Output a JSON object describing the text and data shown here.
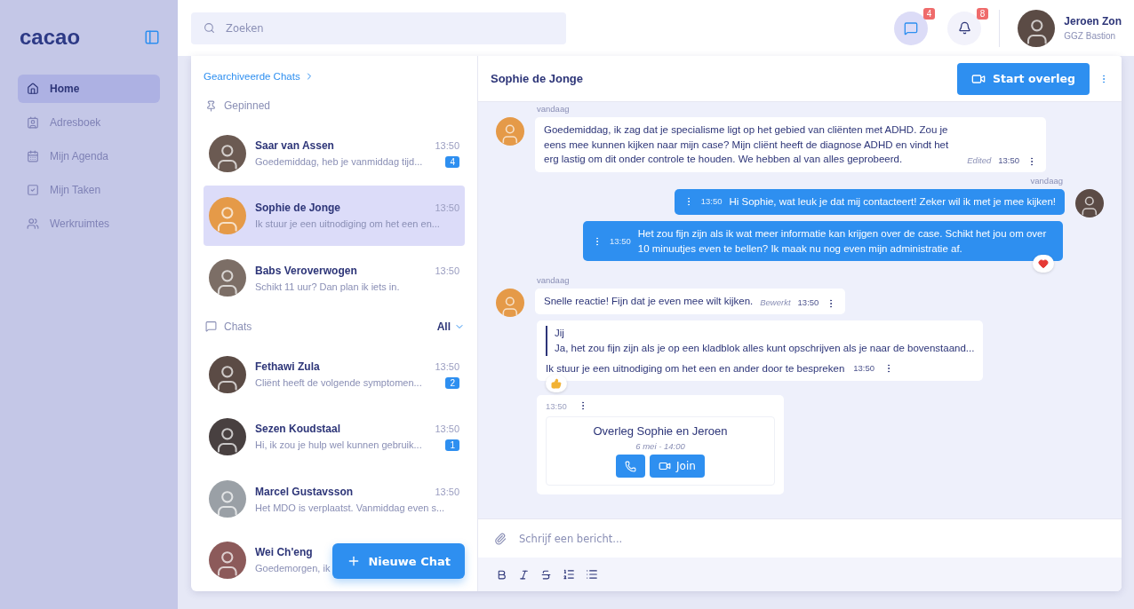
{
  "sidebar": {
    "logo": "cacao",
    "items": [
      {
        "label": "Home",
        "selected": true
      },
      {
        "label": "Adresboek",
        "selected": false
      },
      {
        "label": "Mijn Agenda",
        "selected": false
      },
      {
        "label": "Mijn Taken",
        "selected": false
      },
      {
        "label": "Werkruimtes",
        "selected": false
      }
    ]
  },
  "topbar": {
    "search": {
      "placeholder": "Zoeken"
    },
    "chat_badge": "4",
    "notification_badge": "8",
    "user": {
      "name": "Jeroen Zon",
      "org": "GGZ Bastion"
    }
  },
  "chat_list": {
    "archived_link": "Gearchiveerde Chats",
    "pinned_heading": "Gepinned",
    "pinned": [
      {
        "name": "Saar van Assen",
        "time": "13:50",
        "preview": "Goedemiddag, heb je vanmiddag tijd...",
        "unread": "4",
        "selected": false
      },
      {
        "name": "Sophie de Jonge",
        "time": "13:50",
        "preview": "Ik stuur je een uitnodiging om het een en...",
        "selected": true
      },
      {
        "name": "Babs Veroverwogen",
        "time": "13:50",
        "preview": "Schikt 11 uur? Dan plan ik iets in.",
        "selected": false
      }
    ],
    "chats_heading": "Chats",
    "filter": "All",
    "chats": [
      {
        "name": "Fethawi Zula",
        "time": "13:50",
        "preview": "Cliënt heeft de volgende symptomen...",
        "unread": "2",
        "selected": false
      },
      {
        "name": "Sezen Koudstaal",
        "time": "13:50",
        "preview": "Hi, ik zou je hulp wel kunnen gebruik...",
        "unread": "1",
        "selected": false
      },
      {
        "name": "Marcel Gustavsson",
        "time": "13:50",
        "preview": "Het MDO is verplaatst. Vanmiddag even s...",
        "selected": false
      },
      {
        "name": "Wei Ch'eng",
        "preview": "Goedemorgen, ik",
        "selected": false
      }
    ],
    "new_chat_button": "Nieuwe Chat"
  },
  "conversation": {
    "title": "Sophie de Jonge",
    "start_button": "Start overleg",
    "messages": [
      {
        "kind": "incoming",
        "date": "vandaag",
        "text": "Goedemiddag, ik zag dat je specialisme ligt op het gebied van cliënten met ADHD. Zou je eens mee kunnen kijken naar mijn case? Mijn cliënt heeft de diagnose ADHD en vindt het erg lastig om dit onder controle te houden. We hebben al van alles geprobeerd.",
        "edited": "Edited",
        "time": "13:50"
      },
      {
        "kind": "outgoing",
        "date": "vandaag",
        "text": "Hi Sophie, wat leuk je dat mij contacteert! Zeker wil ik met je mee kijken!",
        "time": "13:50"
      },
      {
        "kind": "outgoing",
        "text": "Het zou fijn zijn als ik wat meer informatie kan krijgen over de case. Schikt het jou om over 10 minuutjes even te bellen? Ik maak nu nog even mijn administratie af.",
        "time": "13:50",
        "reacted": true
      },
      {
        "kind": "incoming",
        "date": "vandaag",
        "text": "Snelle reactie! Fijn dat je even mee wilt kijken.",
        "edited": "Bewerkt",
        "time": "13:50"
      },
      {
        "kind": "quote",
        "quote_author": "Jij",
        "quote_text": "Ja, het zou fijn zijn als je op een kladblok alles kunt opschrijven als je naar de bovenstaand...",
        "text": "Ik stuur je een uitnodiging om het een en ander door te bespreken",
        "time": "13:50",
        "reacted": true
      },
      {
        "kind": "meeting",
        "time": "13:50",
        "title": "Overleg Sophie en Jeroen",
        "when": "6 mei - 14:00",
        "join": "Join"
      }
    ],
    "composer": {
      "placeholder": "Schrijf een bericht..."
    }
  }
}
